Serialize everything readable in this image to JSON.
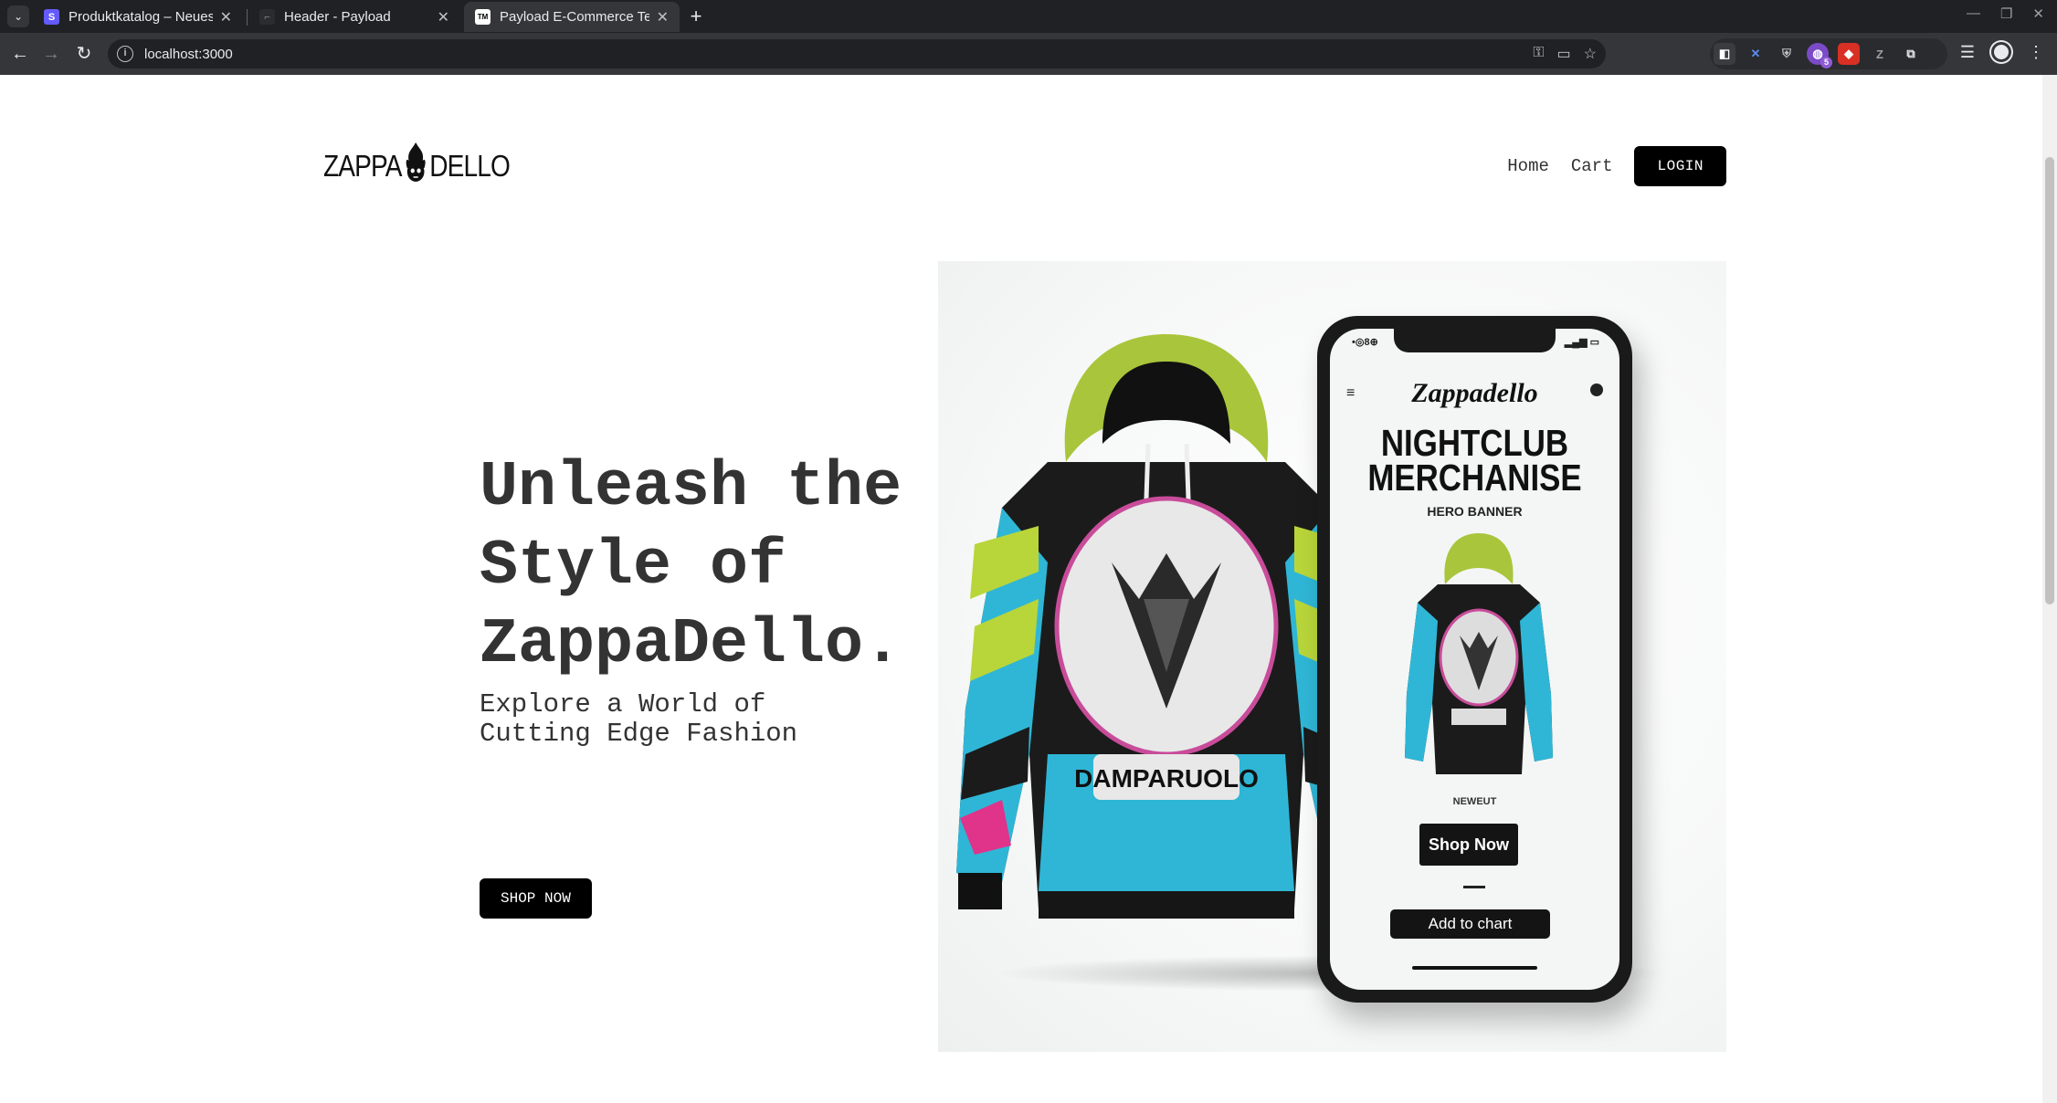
{
  "browser": {
    "tabs": [
      {
        "title": "Produktkatalog – Neues Un",
        "favicon": "S",
        "favicon_color": "#635bff",
        "active": false
      },
      {
        "title": "Header - Payload",
        "favicon": "",
        "favicon_color": "#202124",
        "active": false
      },
      {
        "title": "Payload E-Commerce Temp",
        "favicon": "TM",
        "favicon_color": "#ffffff",
        "active": true
      }
    ],
    "new_tab": "+",
    "url": "localhost:3000",
    "extension_badge": "5"
  },
  "site": {
    "logo": {
      "left": "ZAPPA",
      "right": "DELLO"
    },
    "nav": {
      "home": "Home",
      "cart": "Cart",
      "login": "LOGIN"
    }
  },
  "hero": {
    "title_lines": [
      "Unleash the",
      "Style of",
      "ZappaDello."
    ],
    "subtitle": "Explore a World of\nCutting Edge Fashion",
    "cta": "SHOP NOW"
  },
  "hero_image": {
    "phone": {
      "status_time": "•◎8⊕",
      "brand": "Zappadello",
      "headline_1": "NIGHTCLUB",
      "headline_2": "MERCHANISE",
      "tag": "HERO BANNER",
      "newest": "NEWEUT",
      "shop_button": "Shop Now",
      "cart_button": "Add to chart"
    },
    "hoodie_print": "DAMPARUOLO"
  },
  "colors": {
    "accent": "#000000",
    "text": "#333333",
    "hoodie_lime": "#a9c53b",
    "hoodie_cyan": "#2fb6d6",
    "hoodie_pink": "#e0338a"
  }
}
